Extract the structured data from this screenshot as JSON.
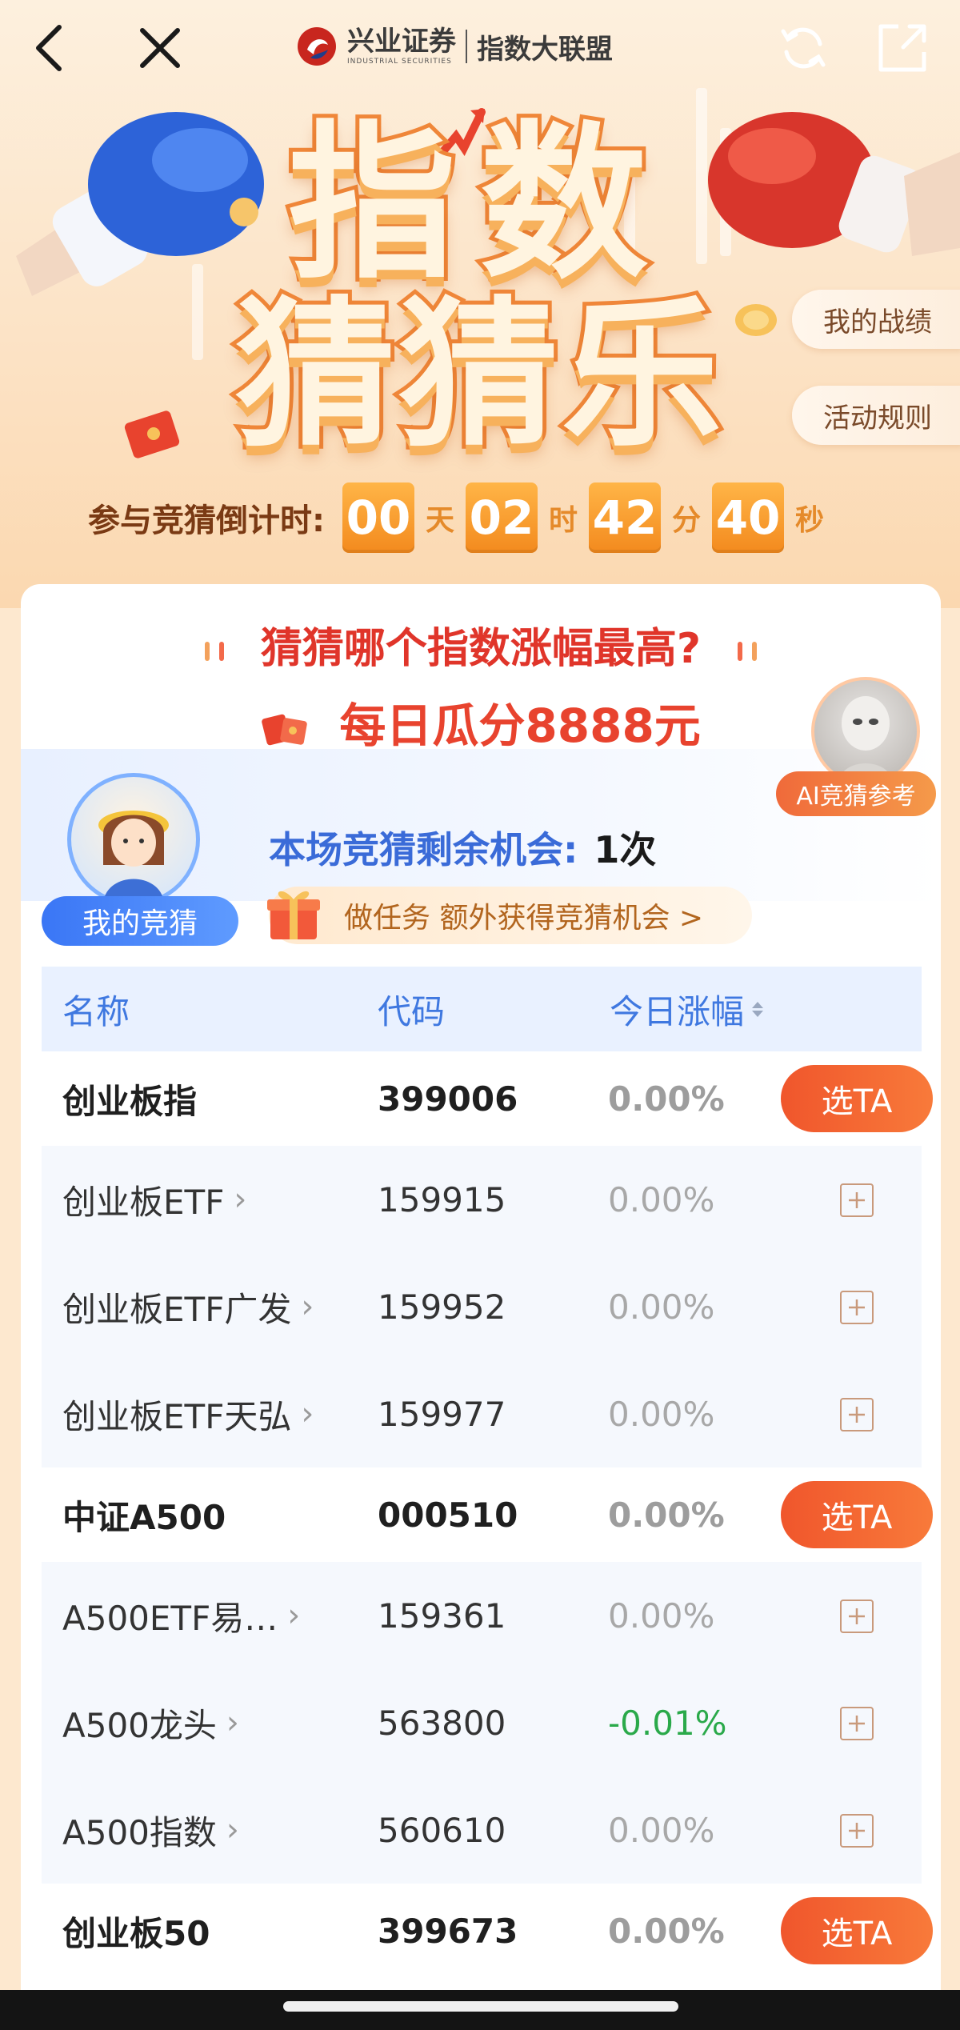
{
  "topbar": {
    "brand_name": "兴业证券",
    "brand_en": "INDUSTRIAL SECURITIES",
    "brand_sub": "指数大联盟"
  },
  "hero": {
    "title_line1": "指数",
    "title_line2": "猜猜乐",
    "my_record": "我的战绩",
    "rules": "活动规则"
  },
  "countdown": {
    "label": "参与竞猜倒计时:",
    "days": "00",
    "days_unit": "天",
    "hours": "02",
    "hours_unit": "时",
    "minutes": "42",
    "minutes_unit": "分",
    "seconds": "40",
    "seconds_unit": "秒"
  },
  "card": {
    "question": "猜猜哪个指数涨幅最高?",
    "prize": "每日瓜分8888元",
    "ai_label": "AI竞猜参考",
    "my_guess": "我的竞猜",
    "remain_label": "本场竞猜剩余机会:",
    "remain_count": "1次",
    "task_text": "做任务 额外获得竞猜机会 >"
  },
  "table": {
    "headers": {
      "name": "名称",
      "code": "代码",
      "change": "今日涨幅"
    },
    "pick_label": "选TA",
    "rows": [
      {
        "type": "index",
        "name": "创业板指",
        "code": "399006",
        "change": "0.00%"
      },
      {
        "type": "etf",
        "name": "创业板ETF",
        "code": "159915",
        "change": "0.00%"
      },
      {
        "type": "etf",
        "name": "创业板ETF广发",
        "code": "159952",
        "change": "0.00%"
      },
      {
        "type": "etf",
        "name": "创业板ETF天弘",
        "code": "159977",
        "change": "0.00%"
      },
      {
        "type": "index",
        "name": "中证A500",
        "code": "000510",
        "change": "0.00%"
      },
      {
        "type": "etf",
        "name": "A500ETF易…",
        "code": "159361",
        "change": "0.00%"
      },
      {
        "type": "etf",
        "name": "A500龙头",
        "code": "563800",
        "change": "-0.01%"
      },
      {
        "type": "etf",
        "name": "A500指数",
        "code": "560610",
        "change": "0.00%"
      },
      {
        "type": "index",
        "name": "创业板50",
        "code": "399673",
        "change": "0.00%"
      }
    ]
  },
  "colors": {
    "accent_orange": "#f0562c",
    "question_red": "#e0352a",
    "header_blue": "#3f78e0",
    "negative_green": "#2aa94a"
  }
}
